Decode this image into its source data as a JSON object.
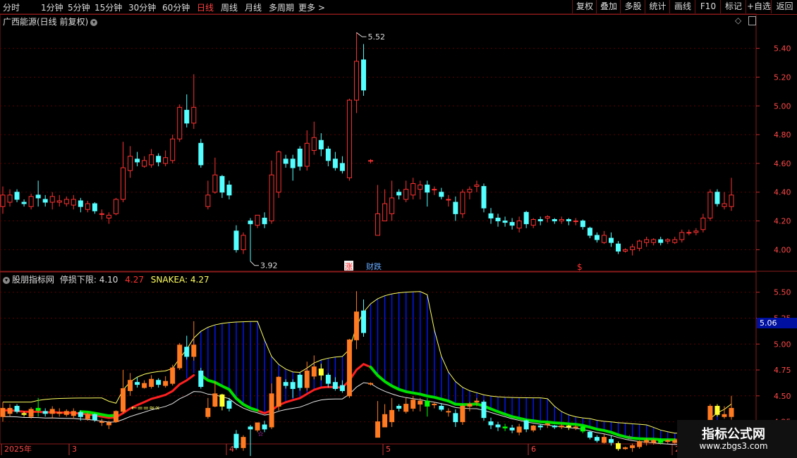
{
  "toolbar": {
    "periods": [
      "分时",
      "1分钟",
      "5分钟",
      "15分钟",
      "30分钟",
      "60分钟",
      "日线",
      "周线",
      "月线",
      "多周期",
      "更多 >"
    ],
    "active_period": "日线",
    "buttons": [
      "复权",
      "叠加",
      "多股",
      "统计",
      "画线",
      "F10",
      "标记",
      "+自选",
      "返回"
    ]
  },
  "top_panel": {
    "title": "广西能源(日线 前复权)",
    "high_label": "5.52",
    "low_label": "3.92",
    "markers": {
      "zhang": "涨",
      "caidie": "财跌",
      "dollar": "$"
    },
    "y_ticks": [
      "5.40",
      "5.20",
      "5.00",
      "4.80",
      "4.60",
      "4.40",
      "4.20",
      "4.00"
    ]
  },
  "bottom_panel": {
    "title": "股朋指标网",
    "stop_label": "停损下限: 4.10",
    "value_label": "4.27",
    "snake_label": "SNAKEA: 4.27",
    "arrow_label": "←==≈∝",
    "current_price": "5.06",
    "y_ticks": [
      "5.50",
      "5.25",
      "5.00",
      "4.75",
      "4.50",
      "4.25"
    ]
  },
  "x_axis": {
    "labels": [
      "2025年",
      "3",
      "4",
      "5",
      "6",
      "20"
    ]
  },
  "watermark": {
    "line1": "指标公式网",
    "line2": "www.zbgs3.com"
  },
  "colors": {
    "up": "#ff3232",
    "down": "#54ffff",
    "bg": "#000000",
    "grid": "#5a0000",
    "snake": "#00e000",
    "trail": "#ff2020",
    "envelope": "#ffff60",
    "fill": "#0018ff"
  },
  "chart_data": {
    "type": "candlestick",
    "ylim_top": [
      3.85,
      5.55
    ],
    "ylim_bottom": [
      4.05,
      5.6
    ],
    "candles": [
      [
        4.3,
        4.38,
        4.25,
        4.44
      ],
      [
        4.33,
        4.38,
        4.3,
        4.42
      ],
      [
        4.4,
        4.35,
        4.33,
        4.42
      ],
      [
        4.33,
        4.32,
        4.3,
        4.35
      ],
      [
        4.3,
        4.37,
        4.28,
        4.39
      ],
      [
        4.38,
        4.36,
        4.3,
        4.48
      ],
      [
        4.35,
        4.33,
        4.3,
        4.38
      ],
      [
        4.33,
        4.37,
        4.28,
        4.4
      ],
      [
        4.33,
        4.34,
        4.3,
        4.38
      ],
      [
        4.32,
        4.35,
        4.3,
        4.37
      ],
      [
        4.31,
        4.35,
        4.28,
        4.38
      ],
      [
        4.34,
        4.3,
        4.26,
        4.36
      ],
      [
        4.28,
        4.32,
        4.26,
        4.34
      ],
      [
        4.32,
        4.27,
        4.25,
        4.33
      ],
      [
        4.25,
        4.25,
        4.21,
        4.28
      ],
      [
        4.22,
        4.24,
        4.18,
        4.26
      ],
      [
        4.25,
        4.35,
        4.24,
        4.36
      ],
      [
        4.35,
        4.57,
        4.33,
        4.75
      ],
      [
        4.55,
        4.65,
        4.5,
        4.72
      ],
      [
        4.63,
        4.61,
        4.58,
        4.68
      ],
      [
        4.58,
        4.62,
        4.57,
        4.65
      ],
      [
        4.59,
        4.66,
        4.57,
        4.7
      ],
      [
        4.65,
        4.61,
        4.58,
        4.67
      ],
      [
        4.6,
        4.64,
        4.58,
        4.69
      ],
      [
        4.62,
        4.77,
        4.6,
        4.8
      ],
      [
        4.77,
        4.99,
        4.75,
        5.01
      ],
      [
        4.97,
        4.88,
        4.85,
        5.08
      ],
      [
        4.88,
        4.99,
        4.84,
        5.22
      ],
      [
        4.74,
        4.59,
        4.57,
        4.77
      ],
      [
        4.3,
        4.38,
        4.28,
        4.48
      ],
      [
        4.4,
        4.52,
        4.39,
        4.64
      ],
      [
        4.51,
        4.4,
        4.36,
        4.52
      ],
      [
        4.45,
        4.38,
        4.35,
        4.48
      ],
      [
        4.13,
        4.0,
        3.98,
        4.17
      ],
      [
        4.0,
        4.1,
        3.97,
        4.12
      ],
      [
        4.2,
        4.18,
        3.92,
        4.22
      ],
      [
        4.17,
        4.24,
        4.15,
        4.24
      ],
      [
        4.22,
        4.18,
        4.15,
        4.26
      ],
      [
        4.2,
        4.52,
        4.18,
        4.62
      ],
      [
        4.4,
        4.68,
        4.36,
        4.69
      ],
      [
        4.63,
        4.6,
        4.57,
        4.66
      ],
      [
        4.63,
        4.57,
        4.48,
        4.66
      ],
      [
        4.7,
        4.58,
        4.55,
        4.72
      ],
      [
        4.58,
        4.74,
        4.55,
        4.83
      ],
      [
        4.69,
        4.78,
        4.66,
        4.89
      ],
      [
        4.76,
        4.7,
        4.65,
        4.81
      ],
      [
        4.7,
        4.62,
        4.58,
        4.72
      ],
      [
        4.63,
        4.57,
        4.55,
        4.68
      ],
      [
        4.6,
        4.55,
        4.53,
        4.65
      ],
      [
        4.5,
        5.04,
        4.48,
        5.05
      ],
      [
        5.04,
        5.31,
        4.95,
        5.51
      ],
      [
        5.32,
        5.11,
        5.07,
        5.43
      ],
      [
        4.62,
        4.62,
        4.6,
        4.63
      ],
      [
        4.1,
        4.25,
        4.1,
        4.45
      ],
      [
        4.2,
        4.32,
        4.2,
        4.42
      ],
      [
        4.25,
        4.36,
        4.2,
        4.48
      ],
      [
        4.4,
        4.38,
        4.35,
        4.42
      ],
      [
        4.35,
        4.42,
        4.33,
        4.48
      ],
      [
        4.38,
        4.46,
        4.35,
        4.5
      ],
      [
        4.42,
        4.45,
        4.35,
        4.48
      ],
      [
        4.45,
        4.4,
        4.3,
        4.48
      ],
      [
        4.42,
        4.42,
        4.38,
        4.44
      ],
      [
        4.4,
        4.37,
        4.35,
        4.43
      ],
      [
        4.35,
        4.35,
        4.3,
        4.38
      ],
      [
        4.33,
        4.25,
        4.2,
        4.37
      ],
      [
        4.25,
        4.4,
        4.22,
        4.42
      ],
      [
        4.4,
        4.42,
        4.35,
        4.44
      ],
      [
        4.44,
        4.45,
        4.4,
        4.48
      ],
      [
        4.44,
        4.29,
        4.26,
        4.46
      ],
      [
        4.25,
        4.22,
        4.18,
        4.29
      ],
      [
        4.22,
        4.2,
        4.16,
        4.25
      ],
      [
        4.2,
        4.19,
        4.16,
        4.23
      ],
      [
        4.19,
        4.17,
        4.14,
        4.22
      ],
      [
        4.15,
        4.2,
        4.12,
        4.23
      ],
      [
        4.26,
        4.18,
        4.15,
        4.27
      ],
      [
        4.17,
        4.21,
        4.15,
        4.22
      ],
      [
        4.21,
        4.2,
        4.17,
        4.23
      ],
      [
        4.22,
        4.23,
        4.19,
        4.24
      ],
      [
        4.21,
        4.2,
        4.18,
        4.22
      ],
      [
        4.2,
        4.21,
        4.18,
        4.23
      ],
      [
        4.21,
        4.2,
        4.17,
        4.22
      ],
      [
        4.2,
        4.2,
        4.17,
        4.22
      ],
      [
        4.2,
        4.16,
        4.14,
        4.21
      ],
      [
        4.15,
        4.1,
        4.08,
        4.16
      ],
      [
        4.1,
        4.07,
        4.05,
        4.12
      ],
      [
        4.05,
        4.1,
        4.04,
        4.13
      ],
      [
        4.08,
        4.05,
        4.02,
        4.12
      ],
      [
        4.04,
        3.99,
        3.97,
        4.06
      ],
      [
        3.99,
        4.0,
        3.98,
        4.01
      ],
      [
        4.0,
        4.02,
        3.96,
        4.04
      ],
      [
        4.01,
        4.06,
        3.99,
        4.07
      ],
      [
        4.05,
        4.07,
        4.02,
        4.09
      ],
      [
        4.05,
        4.07,
        4.03,
        4.08
      ],
      [
        4.07,
        4.05,
        4.03,
        4.09
      ],
      [
        4.06,
        4.07,
        4.04,
        4.08
      ],
      [
        4.05,
        4.07,
        4.04,
        4.09
      ],
      [
        4.07,
        4.12,
        4.05,
        4.14
      ],
      [
        4.12,
        4.12,
        4.1,
        4.14
      ],
      [
        4.12,
        4.13,
        4.1,
        4.15
      ],
      [
        4.14,
        4.22,
        4.12,
        4.25
      ],
      [
        4.22,
        4.4,
        4.2,
        4.42
      ],
      [
        4.4,
        4.32,
        4.3,
        4.42
      ],
      [
        4.3,
        4.32,
        4.28,
        4.4
      ],
      [
        4.3,
        4.38,
        4.27,
        4.5
      ]
    ]
  }
}
